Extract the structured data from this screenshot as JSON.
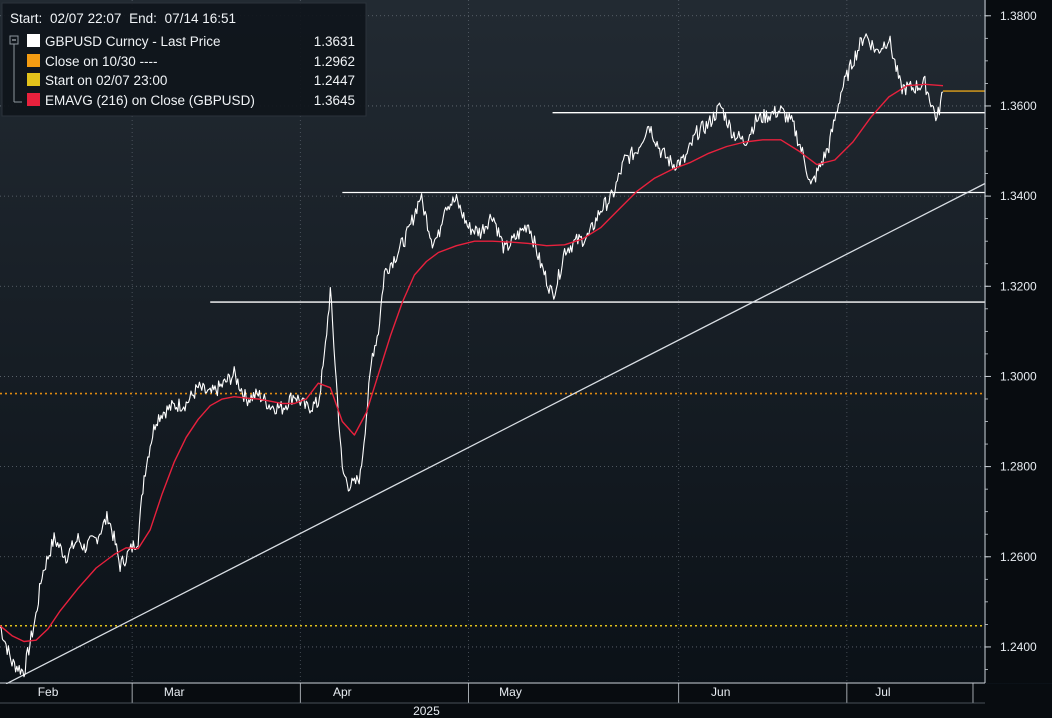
{
  "chart_data": {
    "type": "line",
    "header": {
      "start_label": "Start:",
      "start_value": "02/07 22:07",
      "end_label": "End:",
      "end_value": "07/14 16:51"
    },
    "legend": [
      {
        "name": "GBPUSD Curncy - Last Price",
        "value": "1.3631",
        "color": "#ffffff"
      },
      {
        "name": "Close on 10/30 ----",
        "value": "1.2962",
        "color": "#f39c12"
      },
      {
        "name": "Start on 02/07 23:00",
        "value": "1.2447",
        "color": "#e2c21b"
      },
      {
        "name": "EMAVG (216)  on Close (GBPUSD)",
        "value": "1.3645",
        "color": "#e8213d"
      }
    ],
    "legend_position": "top-left",
    "y_axis": {
      "position": "right",
      "range": [
        1.232,
        1.3835
      ],
      "ticks": [
        1.38,
        1.36,
        1.34,
        1.32,
        1.3,
        1.28,
        1.26,
        1.24
      ],
      "tick_labels": [
        "1.3800",
        "1.3600",
        "1.3400",
        "1.3200",
        "1.3000",
        "1.2800",
        "1.2600",
        "1.2400"
      ]
    },
    "x_axis": {
      "range": [
        "2025-02-07",
        "2025-07-21"
      ],
      "month_labels": [
        {
          "label": "Feb",
          "date": "2025-02-15"
        },
        {
          "label": "Mar",
          "date": "2025-03-08"
        },
        {
          "label": "Apr",
          "date": "2025-04-05"
        },
        {
          "label": "May",
          "date": "2025-05-03"
        },
        {
          "label": "Jun",
          "date": "2025-06-07"
        },
        {
          "label": "Jul",
          "date": "2025-07-04"
        }
      ],
      "year_label": "2025",
      "year_date": "2025-04-19"
    },
    "grid": true,
    "series": [
      {
        "name": "GBPUSD Curncy - Last Price",
        "color": "#ffffff",
        "x": [
          "2025-02-07",
          "2025-02-09",
          "2025-02-11",
          "2025-02-13",
          "2025-02-14",
          "2025-02-16",
          "2025-02-18",
          "2025-02-20",
          "2025-02-21",
          "2025-02-23",
          "2025-02-25",
          "2025-02-26",
          "2025-02-27",
          "2025-02-28",
          "2025-03-02",
          "2025-03-03",
          "2025-03-04",
          "2025-03-05",
          "2025-03-06",
          "2025-03-08",
          "2025-03-10",
          "2025-03-12",
          "2025-03-14",
          "2025-03-16",
          "2025-03-18",
          "2025-03-20",
          "2025-03-22",
          "2025-03-24",
          "2025-03-26",
          "2025-03-28",
          "2025-03-30",
          "2025-04-01",
          "2025-04-02",
          "2025-04-03",
          "2025-04-04",
          "2025-04-05",
          "2025-04-06",
          "2025-04-07",
          "2025-04-08",
          "2025-04-10",
          "2025-04-11",
          "2025-04-12",
          "2025-04-13",
          "2025-04-14",
          "2025-04-16",
          "2025-04-18",
          "2025-04-20",
          "2025-04-21",
          "2025-04-22",
          "2025-04-24",
          "2025-04-26",
          "2025-04-28",
          "2025-04-30",
          "2025-05-02",
          "2025-05-04",
          "2025-05-06",
          "2025-05-08",
          "2025-05-10",
          "2025-05-11",
          "2025-05-12",
          "2025-05-14",
          "2025-05-16",
          "2025-05-18",
          "2025-05-20",
          "2025-05-22",
          "2025-05-24",
          "2025-05-26",
          "2025-05-28",
          "2025-05-30",
          "2025-06-01",
          "2025-06-03",
          "2025-06-05",
          "2025-06-07",
          "2025-06-09",
          "2025-06-11",
          "2025-06-13",
          "2025-06-15",
          "2025-06-17",
          "2025-06-19",
          "2025-06-21",
          "2025-06-22",
          "2025-06-23",
          "2025-06-25",
          "2025-06-27",
          "2025-06-29",
          "2025-07-01",
          "2025-07-02",
          "2025-07-03",
          "2025-07-05",
          "2025-07-07",
          "2025-07-09",
          "2025-07-11",
          "2025-07-13",
          "2025-07-14"
        ],
        "y": [
          1.2447,
          1.2365,
          1.2345,
          1.247,
          1.256,
          1.264,
          1.26,
          1.264,
          1.262,
          1.264,
          1.269,
          1.264,
          1.258,
          1.26,
          1.264,
          1.278,
          1.285,
          1.2905,
          1.292,
          1.2935,
          1.294,
          1.2975,
          1.296,
          1.298,
          1.3005,
          1.295,
          1.296,
          1.2935,
          1.293,
          1.296,
          1.293,
          1.294,
          1.304,
          1.319,
          1.299,
          1.279,
          1.276,
          1.276,
          1.278,
          1.305,
          1.31,
          1.323,
          1.325,
          1.327,
          1.332,
          1.34,
          1.33,
          1.331,
          1.338,
          1.339,
          1.333,
          1.332,
          1.336,
          1.328,
          1.331,
          1.334,
          1.325,
          1.318,
          1.322,
          1.328,
          1.33,
          1.331,
          1.337,
          1.34,
          1.348,
          1.35,
          1.356,
          1.35,
          1.347,
          1.348,
          1.354,
          1.356,
          1.36,
          1.354,
          1.352,
          1.357,
          1.358,
          1.359,
          1.356,
          1.348,
          1.342,
          1.345,
          1.351,
          1.363,
          1.37,
          1.376,
          1.374,
          1.372,
          1.375,
          1.364,
          1.364,
          1.365,
          1.357,
          1.3631
        ]
      },
      {
        "name": "EMAVG (216)  on Close (GBPUSD)",
        "color": "#e8213d",
        "x": [
          "2025-02-07",
          "2025-02-09",
          "2025-02-11",
          "2025-02-13",
          "2025-02-15",
          "2025-02-17",
          "2025-02-20",
          "2025-02-23",
          "2025-02-26",
          "2025-02-28",
          "2025-03-02",
          "2025-03-04",
          "2025-03-06",
          "2025-03-08",
          "2025-03-10",
          "2025-03-12",
          "2025-03-14",
          "2025-03-16",
          "2025-03-18",
          "2025-03-20",
          "2025-03-22",
          "2025-03-24",
          "2025-03-26",
          "2025-03-28",
          "2025-03-30",
          "2025-04-01",
          "2025-04-03",
          "2025-04-05",
          "2025-04-07",
          "2025-04-09",
          "2025-04-11",
          "2025-04-13",
          "2025-04-15",
          "2025-04-17",
          "2025-04-19",
          "2025-04-21",
          "2025-04-24",
          "2025-04-27",
          "2025-04-30",
          "2025-05-03",
          "2025-05-06",
          "2025-05-09",
          "2025-05-12",
          "2025-05-15",
          "2025-05-18",
          "2025-05-21",
          "2025-05-24",
          "2025-05-27",
          "2025-05-30",
          "2025-06-02",
          "2025-06-05",
          "2025-06-08",
          "2025-06-11",
          "2025-06-14",
          "2025-06-17",
          "2025-06-20",
          "2025-06-23",
          "2025-06-26",
          "2025-06-29",
          "2025-07-02",
          "2025-07-05",
          "2025-07-08",
          "2025-07-11",
          "2025-07-14"
        ],
        "y": [
          1.2447,
          1.2425,
          1.2412,
          1.2415,
          1.244,
          1.248,
          1.253,
          1.2575,
          1.2605,
          1.262,
          1.2618,
          1.266,
          1.274,
          1.281,
          1.2865,
          1.2905,
          1.2935,
          1.295,
          1.2955,
          1.2952,
          1.295,
          1.2945,
          1.294,
          1.294,
          1.295,
          1.2985,
          1.2975,
          1.29,
          1.287,
          1.292,
          1.3005,
          1.309,
          1.3165,
          1.3225,
          1.3255,
          1.3275,
          1.329,
          1.33,
          1.33,
          1.3298,
          1.3295,
          1.329,
          1.3292,
          1.3305,
          1.333,
          1.337,
          1.341,
          1.344,
          1.346,
          1.3475,
          1.3495,
          1.351,
          1.352,
          1.3525,
          1.3525,
          1.35,
          1.347,
          1.348,
          1.352,
          1.3575,
          1.362,
          1.3645,
          1.3648,
          1.3645
        ]
      }
    ],
    "horizontal_lines": [
      {
        "y": 1.2962,
        "color": "#e08a10",
        "style": "dotted",
        "from": "2025-02-07",
        "to": "2025-07-21"
      },
      {
        "y": 1.2447,
        "color": "#e2c21b",
        "style": "dotted",
        "from": "2025-02-07",
        "to": "2025-07-21"
      },
      {
        "y": 1.3633,
        "color": "#e2a21b",
        "style": "solid",
        "from": "2025-07-14",
        "to": "2025-07-21"
      },
      {
        "y": 1.3585,
        "color": "#ffffff",
        "style": "solid",
        "from": "2025-05-10",
        "to": "2025-07-21"
      },
      {
        "y": 1.3408,
        "color": "#ffffff",
        "style": "solid",
        "from": "2025-04-05",
        "to": "2025-07-21"
      },
      {
        "y": 1.3165,
        "color": "#ffffff",
        "style": "solid",
        "from": "2025-03-14",
        "to": "2025-07-21"
      }
    ],
    "trend_lines": [
      {
        "from": [
          "2025-02-08",
          1.2318
        ],
        "to": [
          "2025-07-21",
          1.3428
        ],
        "color": "#d8dde3"
      }
    ]
  }
}
